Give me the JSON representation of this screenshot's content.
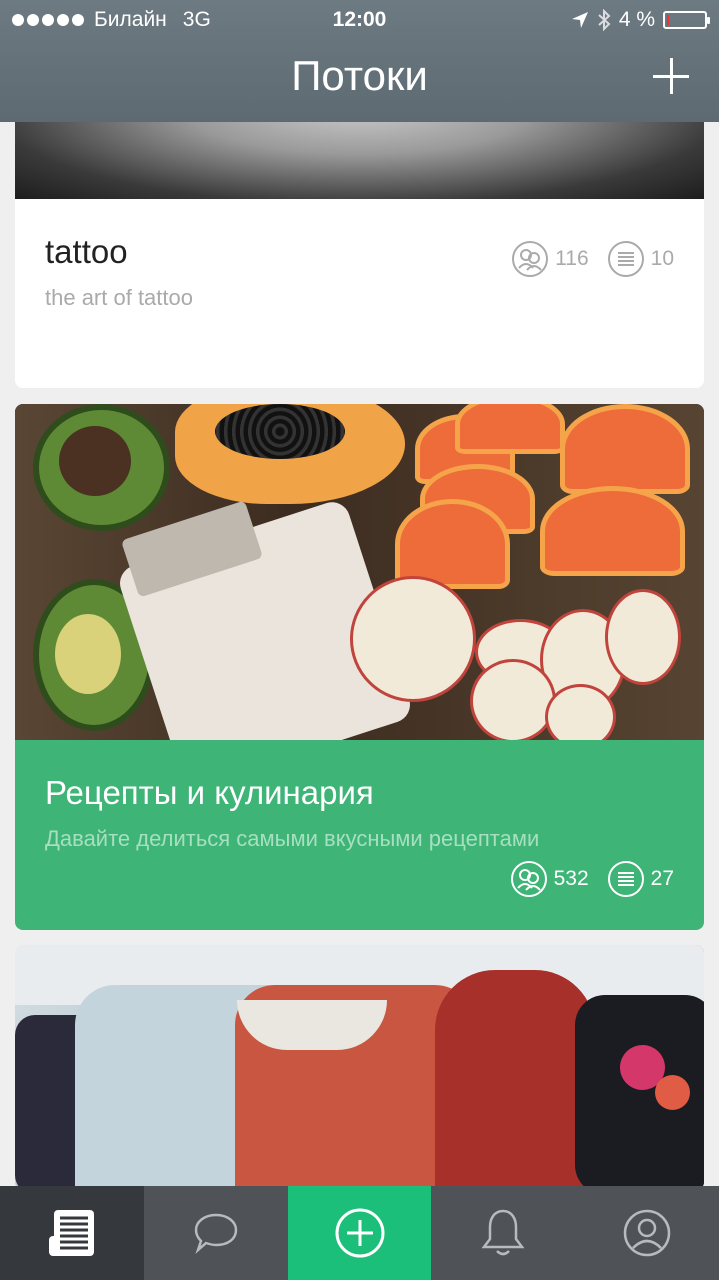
{
  "status_bar": {
    "carrier": "Билайн",
    "network": "3G",
    "time": "12:00",
    "battery": "4 %"
  },
  "header": {
    "title": "Потоки",
    "add_icon": "plus-icon"
  },
  "cards": [
    {
      "title": "tattoo",
      "subtitle": "the art of tattoo",
      "members": "116",
      "posts": "10"
    },
    {
      "title": "Рецепты и кулинария",
      "subtitle": "Давайте делиться самыми вкусными рецептами",
      "members": "532",
      "posts": "27"
    }
  ],
  "tabbar": {
    "items": [
      "feed-icon",
      "chat-icon",
      "compose-icon",
      "bell-icon",
      "profile-icon"
    ],
    "active_index": 0
  },
  "colors": {
    "header": "#5d6a72",
    "accent_green": "#3eb477",
    "compose_green": "#1bbf7a",
    "tabbar": "#4f5358"
  }
}
